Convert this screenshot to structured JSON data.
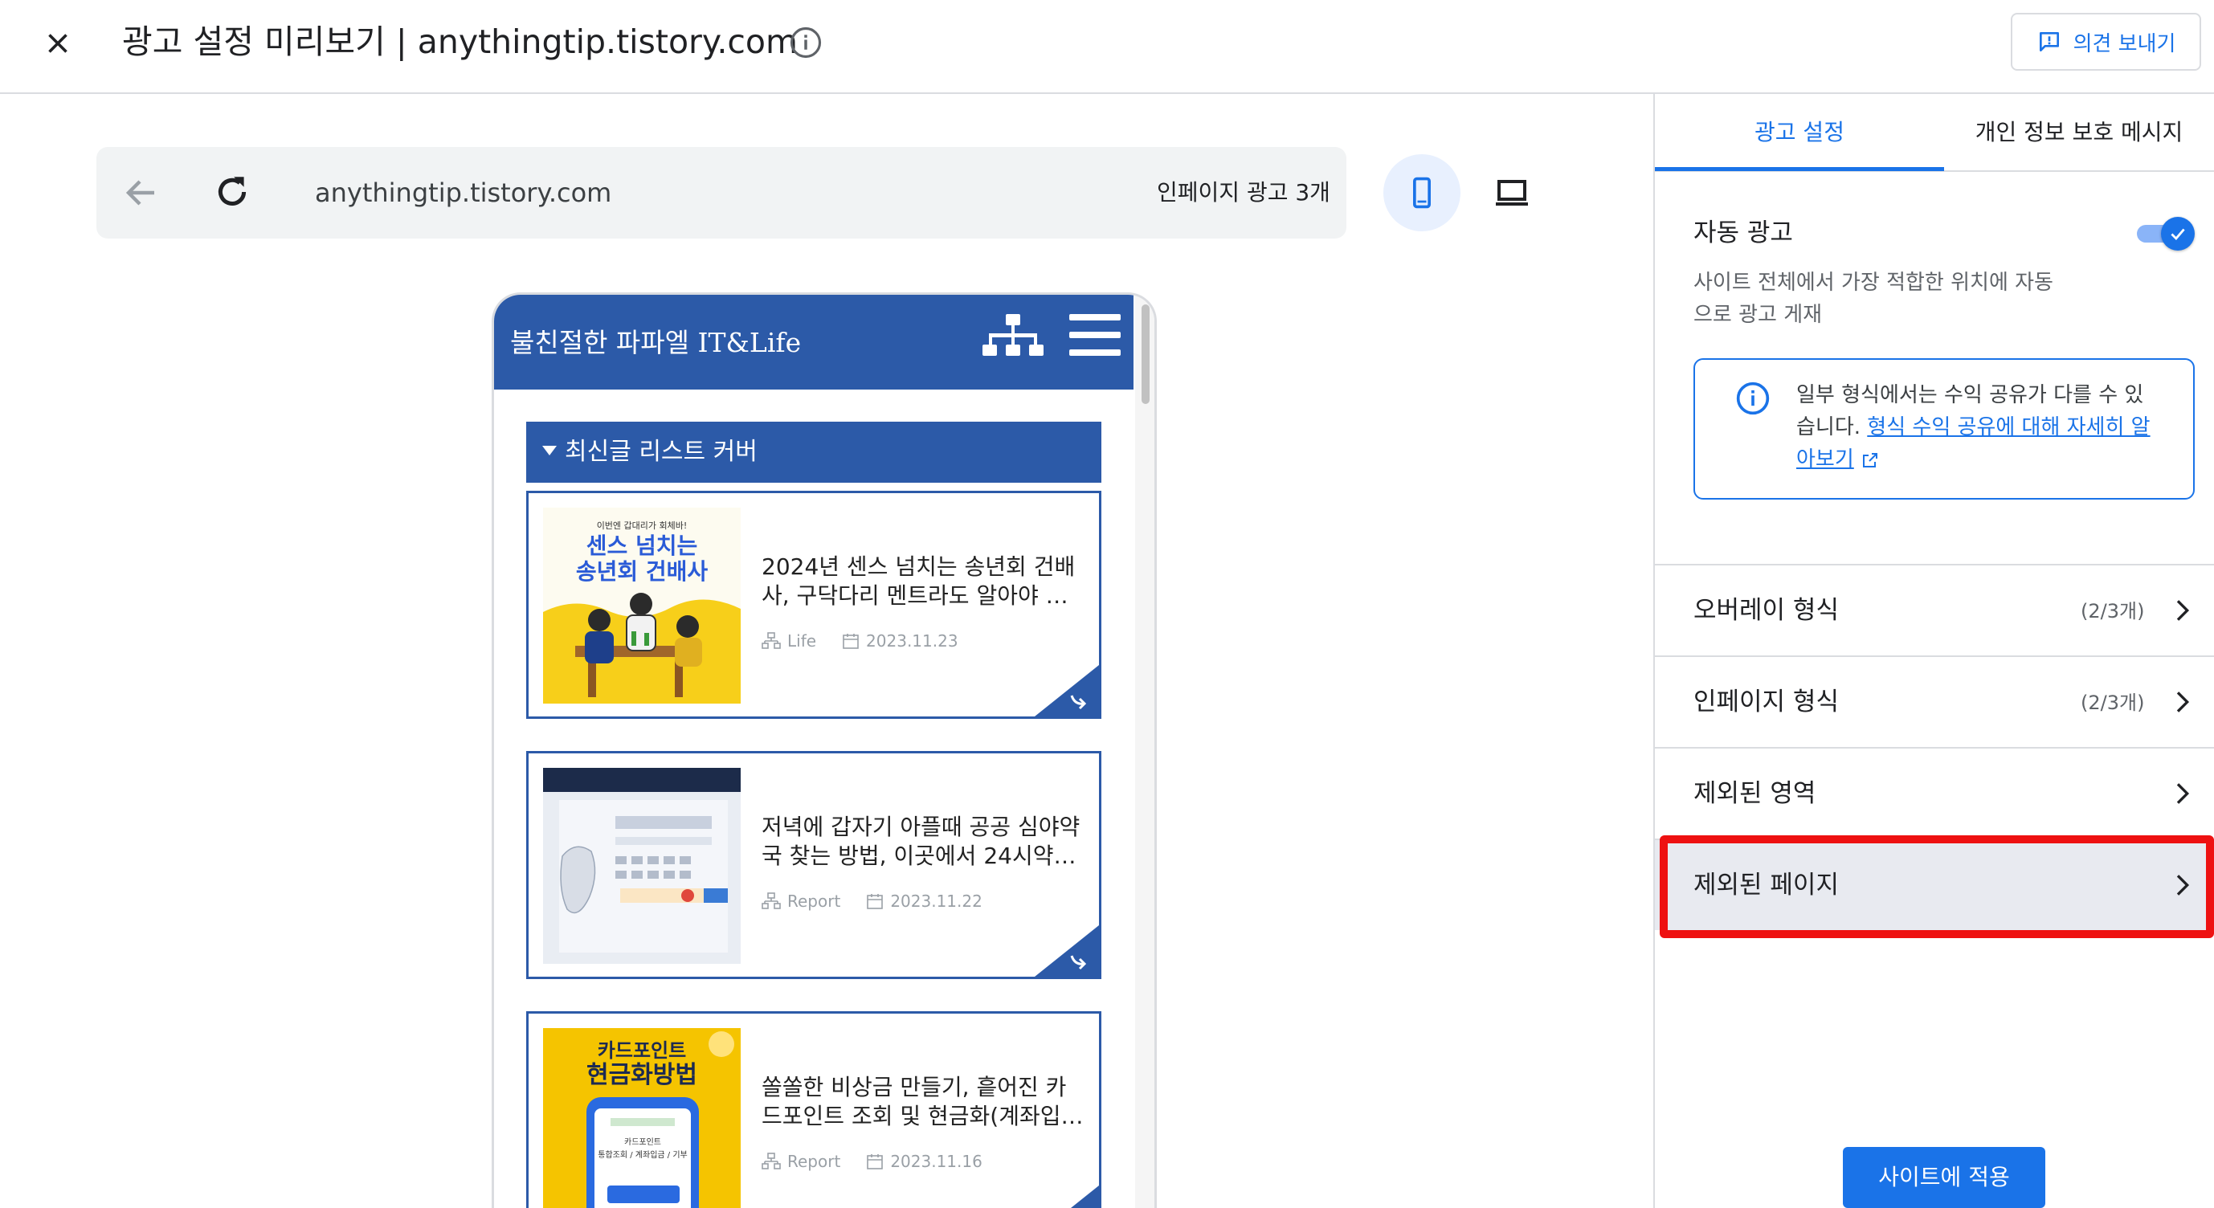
{
  "topbar": {
    "title": "광고 설정 미리보기 | anythingtip.tistory.com",
    "feedback_label": "의견 보내기"
  },
  "preview": {
    "url": "anythingtip.tistory.com",
    "ad_count": "인페이지 광고 3개",
    "blog": {
      "title": "불친절한 파파엘 IT&Life",
      "section_label": "최신글 리스트 커버",
      "posts": [
        {
          "title_line1": "2024년 센스 넘치는 송년회 건배",
          "title_line2": "사, 구닥다리 멘트라도 알아야 …",
          "category": "Life",
          "date": "2023.11.23",
          "thumb": {
            "caption": "이번엔 갑대리가 회체바!",
            "line1": "센스 넘치는",
            "line2": "송년회 건배사"
          }
        },
        {
          "title_line1": "저녁에 갑자기 아플때 공공 심야약",
          "title_line2": "국 찾는 방법, 이곳에서 24시약…",
          "category": "Report",
          "date": "2023.11.22"
        },
        {
          "title_line1": "쏠쏠한 비상금 만들기, 흩어진 카",
          "title_line2": "드포인트 조회 및 현금화(계좌입…",
          "category": "Report",
          "date": "2023.11.16",
          "thumb": {
            "line1": "카드포인트",
            "line2": "현금화방법",
            "phone_line1": "카드포인트",
            "phone_line2": "통합조회 / 계좌입금 / 기부"
          }
        }
      ]
    }
  },
  "panel": {
    "tabs": [
      {
        "label": "광고 설정",
        "active": true
      },
      {
        "label": "개인 정보 보호 메시지",
        "active": false
      }
    ],
    "auto_ads": {
      "title": "자동 광고",
      "enabled": true,
      "desc_line1": "사이트 전체에서 가장 적합한 위치에 자동",
      "desc_line2": "으로 광고 게재"
    },
    "info": {
      "text_line1": "일부 형식에서는 수익 공유가 다를 수 있",
      "text_line2_plain": "습니다.",
      "link_part1": "형식 수익 공유에 대해 자세히 알",
      "link_part2": "아보기"
    },
    "rows": [
      {
        "label": "오버레이 형식",
        "count": "(2/3개)"
      },
      {
        "label": "인페이지 형식",
        "count": "(2/3개)"
      },
      {
        "label": "제외된 영역",
        "count": ""
      },
      {
        "label": "제외된 페이지",
        "count": ""
      }
    ],
    "apply_label": "사이트에 적용"
  },
  "colors": {
    "accent": "#1a73e8",
    "blog_blue": "#2c5aa8",
    "highlight_red": "#ee1111"
  }
}
